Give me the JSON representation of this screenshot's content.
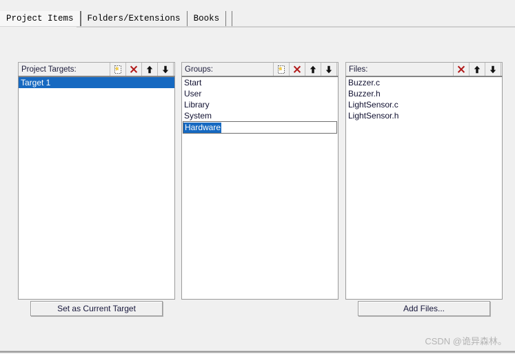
{
  "dialog": {
    "background_color": "#f0f0f0",
    "selection_color": "#1669c1"
  },
  "tabs": [
    {
      "label": "Project Items",
      "selected": true
    },
    {
      "label": "Folders/Extensions",
      "selected": false
    },
    {
      "label": "Books",
      "selected": false
    }
  ],
  "panels": {
    "targets": {
      "header_label": "Project Targets:",
      "tools": [
        {
          "name": "new-item-icon",
          "title": "New (Insert)"
        },
        {
          "name": "delete-icon",
          "title": "Remove Item"
        },
        {
          "name": "arrow-up-icon",
          "title": "Move Up"
        },
        {
          "name": "arrow-down-icon",
          "title": "Move Down"
        }
      ],
      "items": [
        {
          "label": "Target 1",
          "selected": true
        }
      ]
    },
    "groups": {
      "header_label": "Groups:",
      "tools": [
        {
          "name": "new-item-icon",
          "title": "New (Insert)"
        },
        {
          "name": "delete-icon",
          "title": "Remove Item"
        },
        {
          "name": "arrow-up-icon",
          "title": "Move Up"
        },
        {
          "name": "arrow-down-icon",
          "title": "Move Down"
        }
      ],
      "items": [
        {
          "label": "Start",
          "selected": false
        },
        {
          "label": "User",
          "selected": false
        },
        {
          "label": "Library",
          "selected": false
        },
        {
          "label": "System",
          "selected": false
        }
      ],
      "editing_item": {
        "value": "Hardware",
        "text_selected": true
      }
    },
    "files": {
      "header_label": "Files:",
      "tools": [
        {
          "name": "delete-icon",
          "title": "Remove Item"
        },
        {
          "name": "arrow-up-icon",
          "title": "Move Up"
        },
        {
          "name": "arrow-down-icon",
          "title": "Move Down"
        }
      ],
      "items": [
        {
          "label": "Buzzer.c",
          "selected": false
        },
        {
          "label": "Buzzer.h",
          "selected": false
        },
        {
          "label": "LightSensor.c",
          "selected": false
        },
        {
          "label": "LightSensor.h",
          "selected": false
        }
      ]
    }
  },
  "buttons": {
    "set_as_current_target": "Set as Current Target",
    "add_files": "Add Files..."
  },
  "watermark": {
    "text": "CSDN @诡异森林。"
  }
}
